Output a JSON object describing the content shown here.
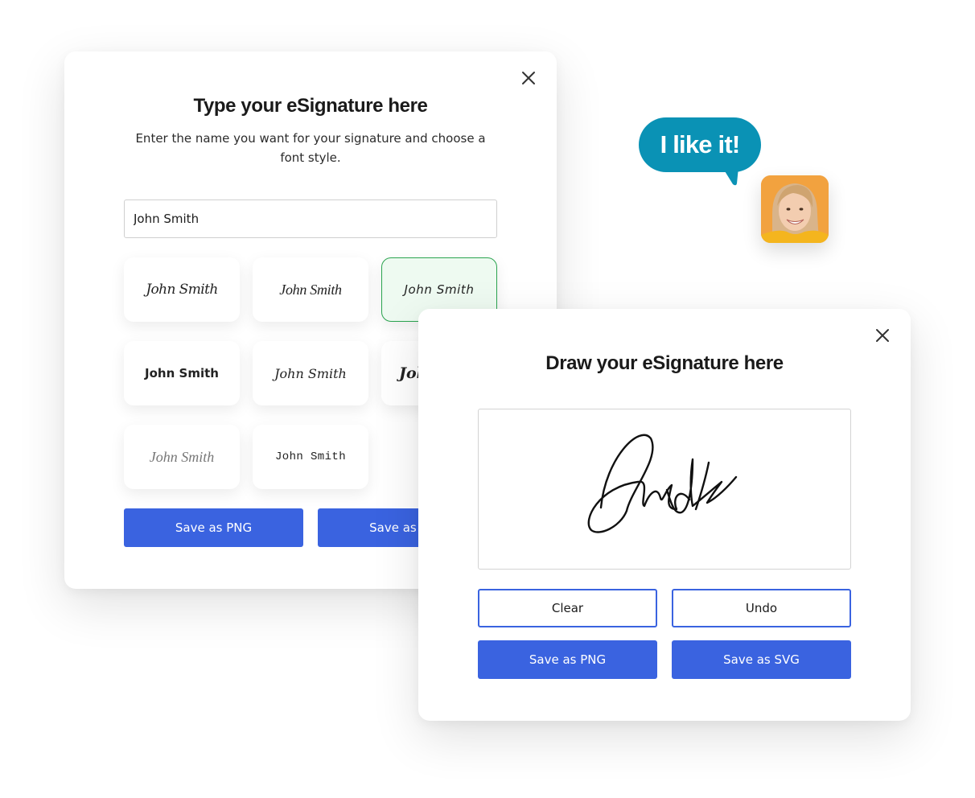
{
  "type_modal": {
    "title": "Type your eSignature here",
    "description": "Enter the name you want for your signature and choose a font style.",
    "name_input_value": "John Smith",
    "font_options": [
      {
        "label": "John Smith",
        "selected": false
      },
      {
        "label": "John Smith",
        "selected": false
      },
      {
        "label": "John Smith",
        "selected": true
      },
      {
        "label": "John Smith",
        "selected": false
      },
      {
        "label": "John Smith",
        "selected": false
      },
      {
        "label": "John Smith",
        "selected": false
      },
      {
        "label": "John Smith",
        "selected": false
      },
      {
        "label": "John Smith",
        "selected": false
      }
    ],
    "save_png_label": "Save as PNG",
    "save_svg_label": "Save as SVG",
    "close_icon": "close-icon"
  },
  "draw_modal": {
    "title": "Draw your eSignature here",
    "canvas_signature": "Smith (handwritten)",
    "clear_label": "Clear",
    "undo_label": "Undo",
    "save_png_label": "Save as PNG",
    "save_svg_label": "Save as SVG",
    "close_icon": "close-icon"
  },
  "reaction": {
    "bubble_text": "I like it!",
    "bubble_color": "#0a92b5",
    "avatar_bg": "#f2a23f"
  },
  "colors": {
    "primary": "#3a63e0",
    "selected_border": "#2aa44f",
    "selected_bg": "#eefaf1"
  }
}
